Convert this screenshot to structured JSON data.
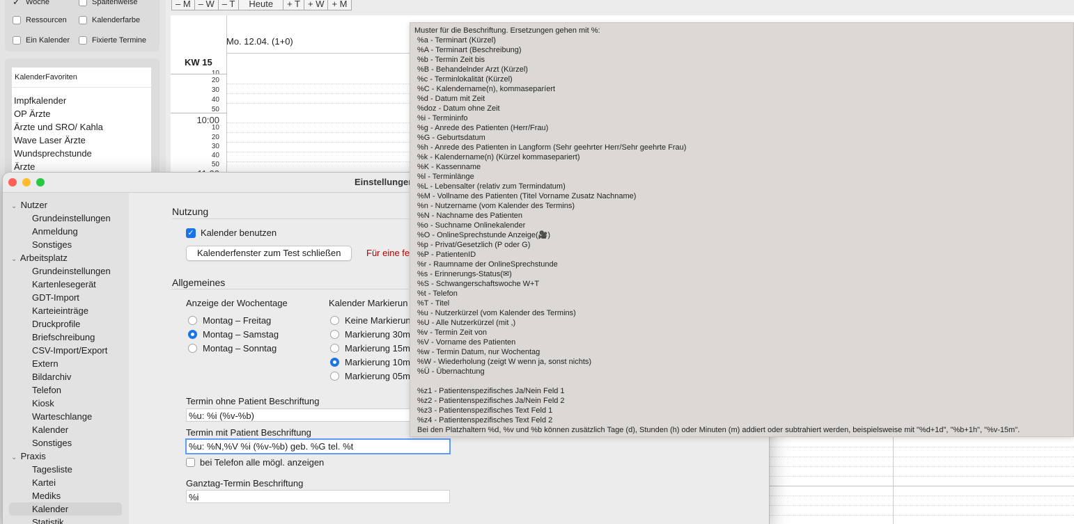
{
  "left_panel": {
    "options": [
      {
        "label": "Woche",
        "checked": true
      },
      {
        "label": "Spaltenweise",
        "checked": false
      },
      {
        "label": "Ressourcen",
        "checked": false
      },
      {
        "label": "Kalenderfarbe",
        "checked": false
      },
      {
        "label": "Ein Kalender",
        "checked": false
      },
      {
        "label": "Fixierte Termine",
        "checked": false
      }
    ],
    "favorites_header": "KalenderFavoriten",
    "favorites": [
      "Impfkalender",
      "OP Ärzte",
      "Ärzte und SRO/ Kahla",
      "Wave Laser Ärzte",
      "Wundsprechstunde",
      "Ärzte"
    ]
  },
  "toolbar": [
    "– M",
    "– W",
    "– T",
    "Heute",
    "+ T",
    "+ W",
    "+ M"
  ],
  "calendar": {
    "week": "KW 15",
    "day_header": "Mo. 12.04. (1+0)",
    "times": [
      "10",
      "20",
      "30",
      "40",
      "50",
      "10:00",
      "10",
      "20",
      "30",
      "40",
      "50",
      "11:00"
    ]
  },
  "dialog": {
    "title": "Einstellungen",
    "sidebar": [
      {
        "label": "Nutzer",
        "level": 0
      },
      {
        "label": "Grundeinstellungen",
        "level": 1
      },
      {
        "label": "Anmeldung",
        "level": 1
      },
      {
        "label": "Sonstiges",
        "level": 1
      },
      {
        "label": "Arbeitsplatz",
        "level": 0
      },
      {
        "label": "Grundeinstellungen",
        "level": 1
      },
      {
        "label": "Kartenlesegerät",
        "level": 1
      },
      {
        "label": "GDT-Import",
        "level": 1
      },
      {
        "label": "Karteieinträge",
        "level": 1
      },
      {
        "label": "Druckprofile",
        "level": 1
      },
      {
        "label": "Briefschreibung",
        "level": 1
      },
      {
        "label": "CSV-Import/Export",
        "level": 1
      },
      {
        "label": "Extern",
        "level": 1
      },
      {
        "label": "Bildarchiv",
        "level": 1
      },
      {
        "label": "Telefon",
        "level": 1
      },
      {
        "label": "Kiosk",
        "level": 1
      },
      {
        "label": "Warteschlange",
        "level": 1
      },
      {
        "label": "Kalender",
        "level": 1
      },
      {
        "label": "Sonstiges",
        "level": 1
      },
      {
        "label": "Praxis",
        "level": 0
      },
      {
        "label": "Tagesliste",
        "level": 1
      },
      {
        "label": "Kartei",
        "level": 1
      },
      {
        "label": "Mediks",
        "level": 1
      },
      {
        "label": "Kalender",
        "level": 1,
        "selected": true
      },
      {
        "label": "Statistik",
        "level": 1
      }
    ],
    "nutzung": {
      "heading": "Nutzung",
      "use_calendar_label": "Kalender benutzen",
      "close_test_button": "Kalenderfenster zum Test schließen",
      "warning": "Für eine fe"
    },
    "allgemeines": {
      "heading": "Allgemeines",
      "weekdays_label": "Anzeige der Wochentage",
      "weekdays": [
        {
          "label": "Montag – Freitag",
          "selected": false
        },
        {
          "label": "Montag – Samstag",
          "selected": true
        },
        {
          "label": "Montag – Sonntag",
          "selected": false
        }
      ],
      "marking_label": "Kalender Markierun",
      "markings": [
        {
          "label": "Keine Markierun",
          "selected": false
        },
        {
          "label": "Markierung 30m",
          "selected": false
        },
        {
          "label": "Markierung 15m",
          "selected": false
        },
        {
          "label": "Markierung 10m",
          "selected": true
        },
        {
          "label": "Markierung 05m",
          "selected": false
        }
      ]
    },
    "fields": {
      "without_patient_label": "Termin ohne Patient Beschriftung",
      "without_patient_value": "%u: %i (%v-%b)",
      "with_patient_label": "Termin mit Patient Beschriftung",
      "with_patient_value": "%u: %N,%V %i (%v-%b) geb. %G tel. %t",
      "phone_all_label": "bei Telefon alle mögl. anzeigen",
      "allday_label": "Ganztag-Termin Beschriftung",
      "allday_value": "%i"
    }
  },
  "tooltip": {
    "lines": [
      "Muster für die Beschriftung. Ersetzungen gehen mit %:",
      "%a - Terminart (Kürzel)",
      "%A - Terminart (Beschreibung)",
      "%b - Termin Zeit bis",
      "%B - Behandelnder Arzt (Kürzel)",
      "%c - Terminlokalität (Kürzel)",
      "%C - Kalendername(n), kommaseparíert",
      "%d - Datum mit Zeit",
      "%doz - Datum ohne Zeit",
      "%i - Termininfo",
      "%g - Anrede des Patienten (Herr/Frau)",
      "%G - Geburtsdatum",
      "%h - Anrede des Patienten in Langform (Sehr geehrter Herr/Sehr geehrte Frau)",
      "%k - Kalendername(n) (Kürzel kommasepariert)",
      "%K - Kassenname",
      "%l - Terminlänge",
      "%L - Lebensalter (relativ zum Termindatum)",
      "%M - Vollname des Patienten (Titel Vorname Zusatz Nachname)",
      "%n - Nutzername (vom Kalender des Termins)",
      "%N - Nachname des Patienten",
      "%o - Suchname Onlinekalender",
      "%O - OnlineSprechstunde Anzeige(🎥)",
      "%p - Privat/Gesetzlich (P oder G)",
      "%P - PatientenID",
      "%r - Raumname der OnlineSprechstunde",
      "%s - Erinnerungs-Status(✉)",
      "%S - Schwangerschaftswoche W+T",
      "%t - Telefon",
      "%T - Titel",
      "%u - Nutzerkürzel (vom Kalender des Termins)",
      "%U - Alle Nutzerkürzel (mit ,)",
      "%v - Termin Zeit von",
      "%V - Vorname des Patienten",
      "%w - Termin Datum, nur Wochentag",
      "%W - Wiederholung (zeigt W wenn ja, sonst nichts)",
      "%Ü - Übernachtung",
      "",
      "%z1 - Patientenspezifisches Ja/Nein Feld 1",
      "%z2 - Patientenspezifisches Ja/Nein Feld 2",
      "%z3 - Patientenspezifisches Text Feld 1",
      "%z4 - Patientenspezifisches Text Feld 2",
      "Bei den Platzhaltern %d, %v und %b können zusätzlich Tage (d), Stunden (h) oder Minuten (m) addiert oder subtrahiert werden, beispielsweise mit \"%d+1d\", \"%b+1h\", \"%v-15m\"."
    ]
  },
  "colors": {
    "accent": "#1a73e8",
    "warning": "#b00000",
    "close": "#fe5f57",
    "minimize": "#febc2e",
    "zoom": "#28c840"
  }
}
